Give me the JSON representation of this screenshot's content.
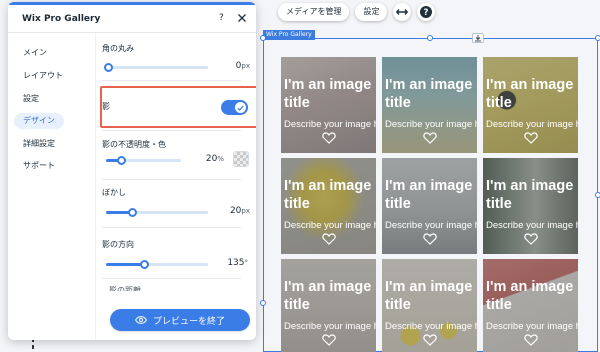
{
  "toolbar": {
    "manage_media_label": "メディアを管理",
    "settings_label": "設定",
    "stretch_icon": "horizontal-arrows-icon",
    "help_icon": "question-circle-icon"
  },
  "gallery": {
    "tag_label": "Wix Pro Gallery",
    "anchor_icon": "download-anchor-icon",
    "tiles": [
      {
        "title": "I'm an image title",
        "description": "Describe your image here",
        "icon": "heart-icon"
      },
      {
        "title": "I'm an image title",
        "description": "Describe your image here",
        "icon": "heart-icon"
      },
      {
        "title": "I'm an image title",
        "description": "Describe your image here",
        "icon": "heart-icon"
      },
      {
        "title": "I'm an image title",
        "description": "Describe your image here",
        "icon": "heart-icon"
      },
      {
        "title": "I'm an image title",
        "description": "Describe your image here",
        "icon": "heart-icon"
      },
      {
        "title": "I'm an image title",
        "description": "Describe your image here",
        "icon": "heart-icon"
      },
      {
        "title": "I'm an image title",
        "description": "Describe your image here",
        "icon": "heart-icon"
      },
      {
        "title": "I'm an image title",
        "description": "Describe your image here",
        "icon": "heart-icon"
      },
      {
        "title": "I'm an image title",
        "description": "Describe your image here",
        "icon": "heart-icon"
      }
    ]
  },
  "panel": {
    "title": "Wix Pro Gallery",
    "help_label": "?",
    "close_icon": "close-icon",
    "nav": [
      {
        "label": "メイン",
        "active": false
      },
      {
        "label": "レイアウト",
        "active": false
      },
      {
        "label": "設定",
        "active": false
      },
      {
        "label": "デザイン",
        "active": true
      },
      {
        "label": "詳細設定",
        "active": false
      },
      {
        "label": "サポート",
        "active": false
      }
    ],
    "corner_radius": {
      "label": "角の丸み",
      "value": "0",
      "unit": "px",
      "level": 0.02
    },
    "shadow": {
      "label": "影",
      "enabled": true
    },
    "shadow_opacity": {
      "label": "影の不透明度・色",
      "value": "20",
      "unit": "%",
      "level": 0.2
    },
    "blur": {
      "label": "ぼかし",
      "value": "20",
      "unit": "px",
      "level": 0.25
    },
    "direction": {
      "label": "影の方向",
      "value": "135",
      "unit": "°",
      "level": 0.37
    },
    "next_label_cut": "影の距離",
    "preview_button_label": "プレビューを終了",
    "preview_icon": "eye-icon"
  },
  "colors": {
    "accent": "#3B7DE6",
    "highlight": "#E8614D",
    "selection": "#3C7BE0"
  }
}
